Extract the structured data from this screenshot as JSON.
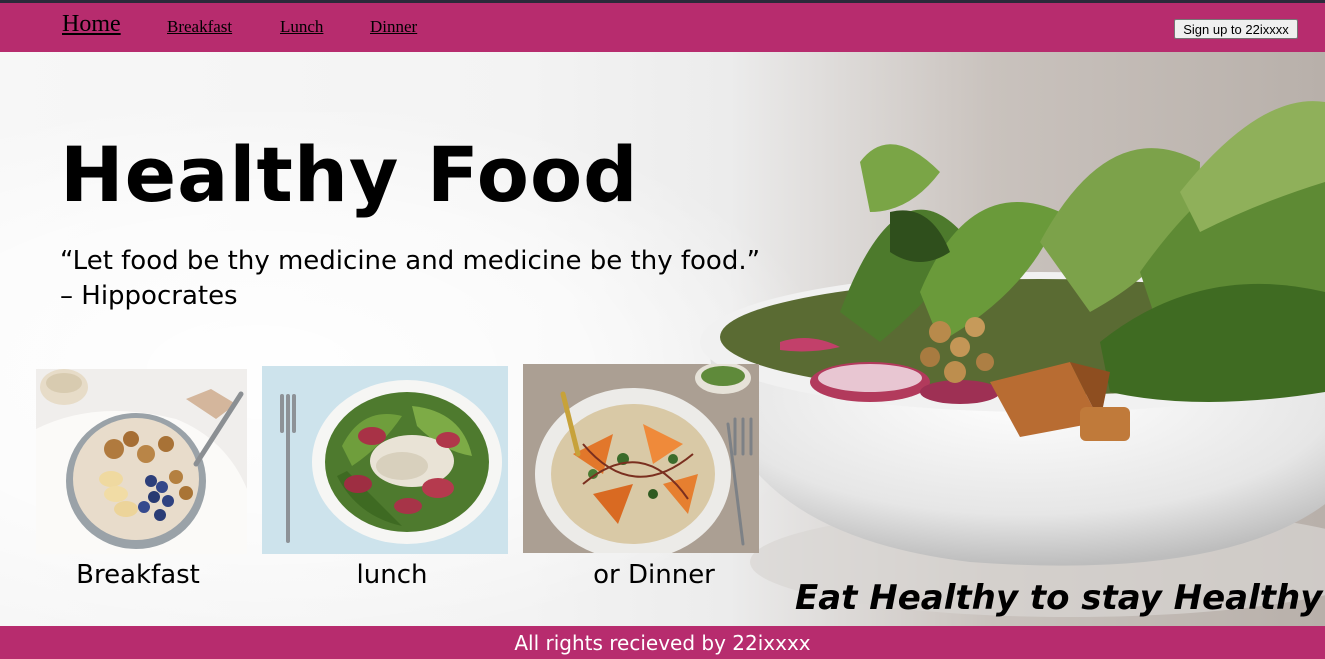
{
  "nav": {
    "home": "Home",
    "breakfast": "Breakfast",
    "lunch": "Lunch",
    "dinner": "Dinner",
    "signup": "Sign up to 22ixxxx"
  },
  "hero": {
    "title": "Healthy Food",
    "quote_line1": "“Let food be thy medicine and medicine be thy food.”",
    "quote_line2": "– Hippocrates",
    "slogan": "Eat Healthy to stay Healthy"
  },
  "cards": [
    {
      "label": "Breakfast",
      "image": "oatmeal-bowl-image"
    },
    {
      "label": "lunch",
      "image": "chicken-salad-image"
    },
    {
      "label": "or Dinner",
      "image": "vegetable-plate-image"
    }
  ],
  "footer": {
    "text": "All rights recieved by 22ixxxx"
  },
  "colors": {
    "brand": "#b72c6e"
  }
}
